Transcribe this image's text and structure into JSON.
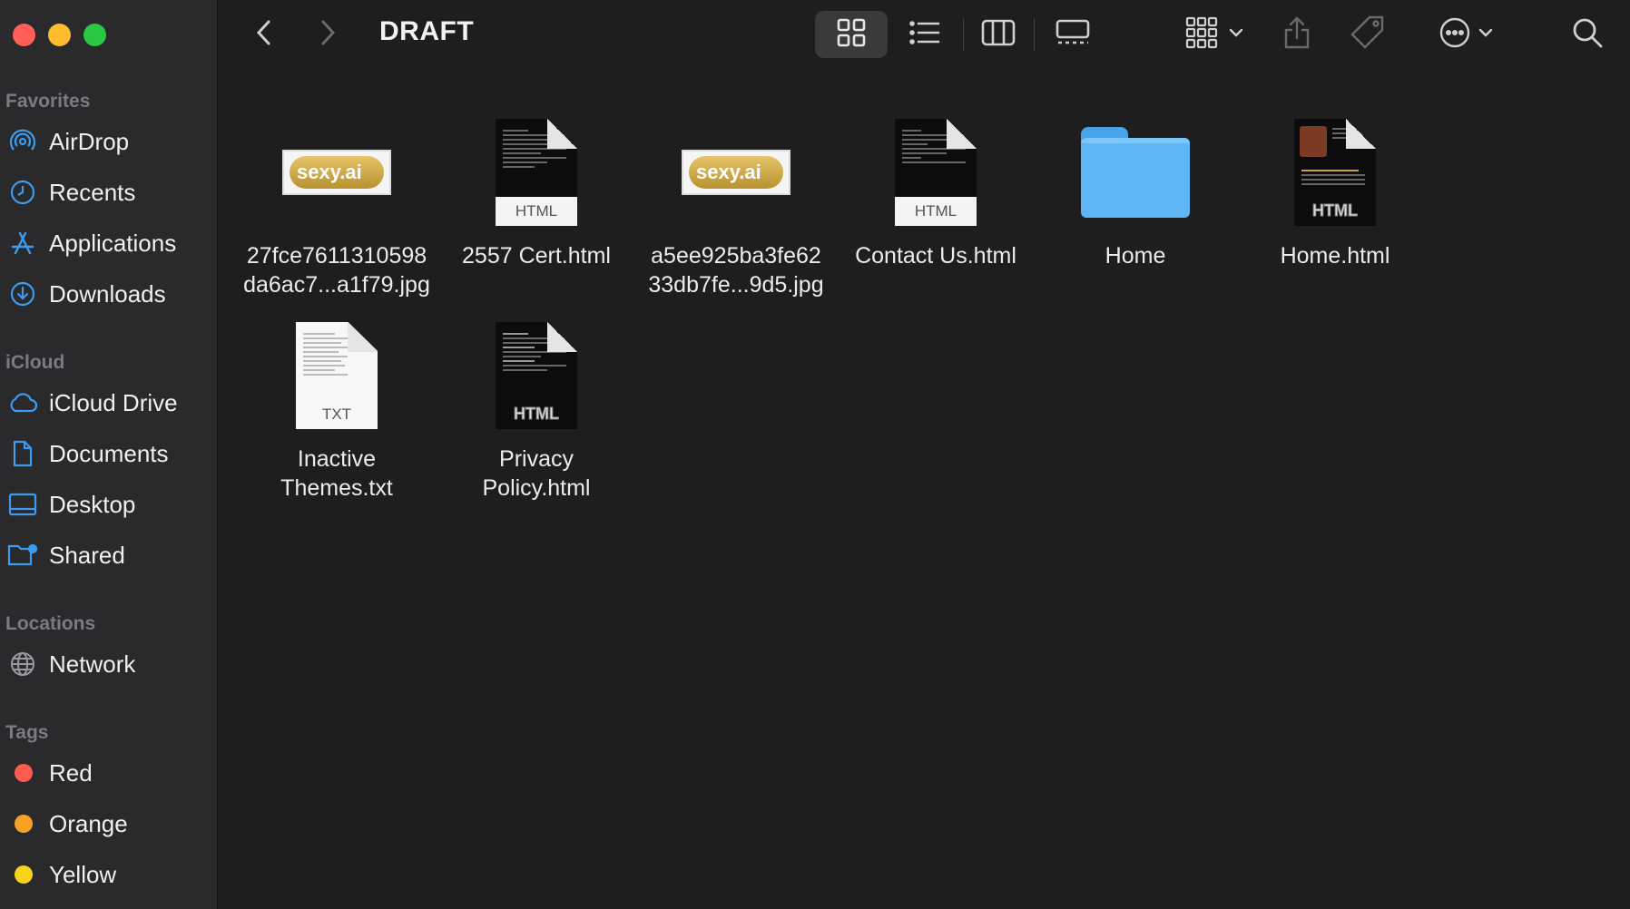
{
  "window": {
    "traffic_colors": {
      "close": "#ff5f57",
      "minimize": "#febc2e",
      "zoom": "#28c840"
    }
  },
  "toolbar": {
    "back_icon": "chevron-left-icon",
    "forward_icon": "chevron-right-icon",
    "title": "DRAFT",
    "view_icons": [
      "icon-view",
      "list-view",
      "column-view",
      "gallery-view"
    ],
    "active_view": "icon-view"
  },
  "sidebar": {
    "favorites_title": "Favorites",
    "favorites": [
      {
        "label": "AirDrop",
        "icon": "airdrop-icon"
      },
      {
        "label": "Recents",
        "icon": "clock-icon"
      },
      {
        "label": "Applications",
        "icon": "applications-icon"
      },
      {
        "label": "Downloads",
        "icon": "download-icon"
      }
    ],
    "icloud_title": "iCloud",
    "icloud": [
      {
        "label": "iCloud Drive",
        "icon": "cloud-icon"
      },
      {
        "label": "Documents",
        "icon": "document-icon"
      },
      {
        "label": "Desktop",
        "icon": "desktop-icon"
      },
      {
        "label": "Shared",
        "icon": "shared-folder-icon"
      }
    ],
    "locations_title": "Locations",
    "locations": [
      {
        "label": "Network",
        "icon": "globe-icon"
      }
    ],
    "tags_title": "Tags",
    "tags": [
      {
        "label": "Red",
        "color": "#ff5b4f"
      },
      {
        "label": "Orange",
        "color": "#f7a126"
      },
      {
        "label": "Yellow",
        "color": "#f9d31b"
      }
    ]
  },
  "files": [
    {
      "name": "27fce7611310598\nda6ac7...a1f79.jpg",
      "kind": "image",
      "thumb_text": "sexy.ai"
    },
    {
      "name": "2557 Cert.html",
      "kind": "html",
      "badge": "HTML"
    },
    {
      "name": "a5ee925ba3fe62\n33db7fe...9d5.jpg",
      "kind": "image",
      "thumb_text": "sexy.ai"
    },
    {
      "name": "Contact Us.html",
      "kind": "html",
      "badge": "HTML"
    },
    {
      "name": "Home",
      "kind": "folder"
    },
    {
      "name": "Home.html",
      "kind": "html-preview",
      "badge": "HTML"
    },
    {
      "name": "Inactive\nThemes.txt",
      "kind": "txt",
      "badge": "TXT"
    },
    {
      "name": "Privacy\nPolicy.html",
      "kind": "html-preview",
      "badge": "HTML"
    }
  ]
}
